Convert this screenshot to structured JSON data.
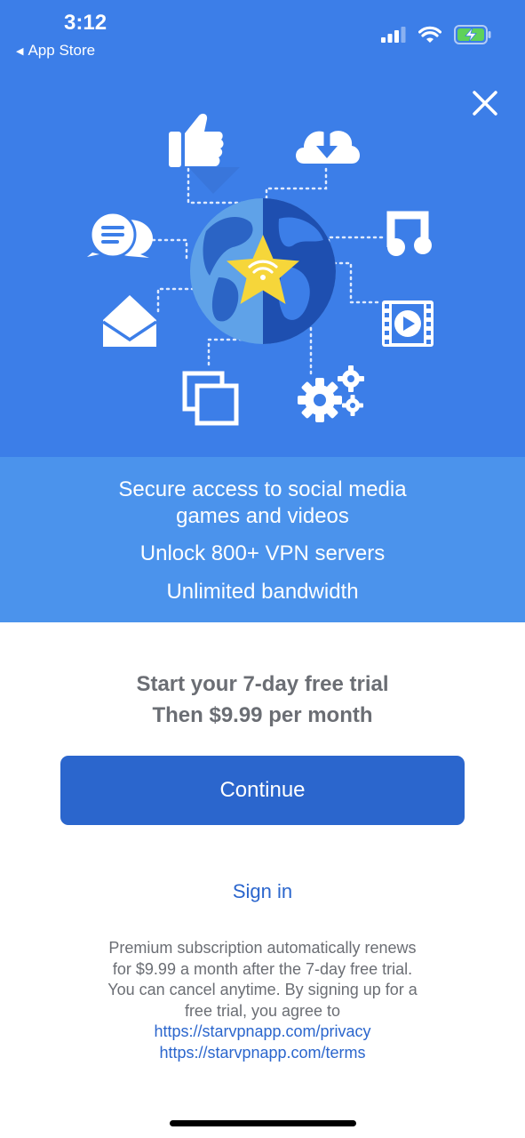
{
  "status_bar": {
    "time": "3:12",
    "back_app": "App Store",
    "icons": [
      "signal-icon",
      "wifi-icon",
      "battery-charging-icon"
    ]
  },
  "hero": {
    "close_icon": "close-icon",
    "illustration_icons": [
      "thumbs-up-icon",
      "cloud-download-icon",
      "chat-icon",
      "music-note-icon",
      "mail-icon",
      "video-icon",
      "photos-icon",
      "gears-icon",
      "globe-star-icon"
    ],
    "colors": {
      "background": "#3c7ee8",
      "globe_dark": "#1e4fb0",
      "globe_light": "#5fa2e8",
      "star": "#f6d63a"
    }
  },
  "features": {
    "line1": "Secure access to social media",
    "line2": "games and videos",
    "line3": "Unlock 800+ VPN servers",
    "line4": "Unlimited bandwidth"
  },
  "offer": {
    "line1": "Start your 7-day free trial",
    "line2": "Then $9.99 per month"
  },
  "continue_label": "Continue",
  "signin_label": "Sign in",
  "legal": {
    "line1": "Premium subscription automatically renews",
    "line2": "for $9.99 a month after the 7-day free trial.",
    "line3": "You can cancel anytime. By signing up for a",
    "line4": "free trial, you agree to",
    "privacy_link": "https://starvpnapp.com/privacy",
    "terms_link": "https://starvpnapp.com/terms"
  },
  "accent_color": "#2b66cd"
}
